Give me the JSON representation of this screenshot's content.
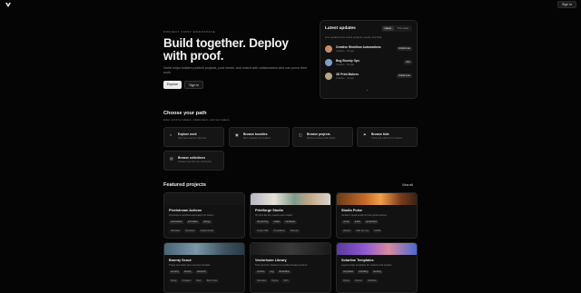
{
  "topbar": {
    "signin_label": "Sign in"
  },
  "hero": {
    "eyebrow": "PROJECT FIRST WORKSPACE",
    "title": "Build together. Deploy with proof.",
    "subtitle": "Vorbit helps builders publish projects, post needs, and match with collaborators who can prove their work.",
    "explore_label": "Explore",
    "signin_label": "Sign in"
  },
  "updates": {
    "title": "Latest updates",
    "tabs": [
      {
        "label": "Latest",
        "active": true
      },
      {
        "label": "This week",
        "active": false
      }
    ],
    "description": "Live updates from active projects, needs, and bids.",
    "items": [
      {
        "name": "Creative Workflow Automations",
        "meta": "Creative · 2d ago",
        "badge": "Collaborate",
        "color": "#c98b6a"
      },
      {
        "name": "Bug Bounty Ops",
        "meta": "Creative · 3d ago",
        "badge": "Hire",
        "color": "#7ea0c8"
      },
      {
        "name": "3D Print Makers",
        "meta": "Creative · 4d ago",
        "badge": "Collaborate",
        "color": "#b7a48b"
      }
    ]
  },
  "path": {
    "title": "Choose your path",
    "subtitle": "Enter vorbit by builders, collaborators, and tool makers.",
    "cards": [
      {
        "icon": "⌕",
        "icon_name": "search-icon",
        "title": "Explore work",
        "desc": "Start here and then discover."
      },
      {
        "icon": "▣",
        "icon_name": "bounty-icon",
        "title": "Browse bounties",
        "desc": "Earn rewards from builders."
      },
      {
        "icon": "◫",
        "icon_name": "projects-icon",
        "title": "Browse projects",
        "desc": "Discover active public builds."
      },
      {
        "icon": "⚑",
        "icon_name": "bids-icon",
        "title": "Browse bids",
        "desc": "Track and submit from builders."
      },
      {
        "icon": "▤",
        "icon_name": "collections-icon",
        "title": "Browse collections",
        "desc": "Curated sets from the community."
      }
    ]
  },
  "featured": {
    "title": "Featured projects",
    "view_all": "View all",
    "projects": [
      {
        "name": "Pixelstream Actions",
        "desc": "Promotions workflow automation for teams.",
        "tags": [
          "automation",
          "animation",
          "design"
        ],
        "foot": [
          "Illustrator",
          "Illustrator",
          "Adobe Firefly"
        ],
        "img": ""
      },
      {
        "name": "Printforge Studio",
        "desc": "3D print file kits, assets and models.",
        "tags": [
          "3d-printing",
          "maker",
          "hardware"
        ],
        "foot": [
          "Fusion 360",
          "PrusaSlicer",
          "Blender"
        ],
        "img": "linear-gradient(90deg,#b8b8c4,#e6e2d8 30%,#7f9a8a 55%,#c5a98c 75%,#d9d4cc)"
      },
      {
        "name": "Studio Pulse",
        "desc": "Ambient media studio for live performances.",
        "tags": [
          "music",
          "audio",
          "production"
        ],
        "foot": [
          "Ableton",
          "Max for Live",
          "LMMS"
        ],
        "img": "linear-gradient(90deg,#6b3a18,#c46a2a 35%,#f0a04a 55%,#7a3c1c 80%,#3c2012)"
      },
      {
        "name": "Bounty Scout",
        "desc": "Triage and track open security bounties.",
        "tags": [
          "security",
          "bounty",
          "research"
        ],
        "foot": [
          "Nmap",
          "Finagent",
          "Burp",
          "Burp Suite"
        ],
        "img": "linear-gradient(90deg,#4a6474,#7a98a8 40%,#3e5460 75%,#2a3a44)"
      },
      {
        "name": "Vectorloom Library",
        "desc": "SVG and icon libraries for product design systems.",
        "tags": [
          "vectors",
          "svg",
          "illustration"
        ],
        "foot": [
          "Illustrator",
          "Figma",
          "SVG"
        ],
        "img": "linear-gradient(90deg,#1a1a1a,#3a3a3a 50%,#1a1a1a)"
      },
      {
        "name": "Solarline Templates",
        "desc": "Layout-ready templates for creators and product.",
        "tags": [
          "templates",
          "branding",
          "landing"
        ],
        "foot": [
          "Figma",
          "Framer",
          "Webflow"
        ],
        "img": "linear-gradient(90deg,#5a3aa0,#8e5ad0 35%,#d88aa0 65%,#4a6ad0)"
      }
    ]
  }
}
